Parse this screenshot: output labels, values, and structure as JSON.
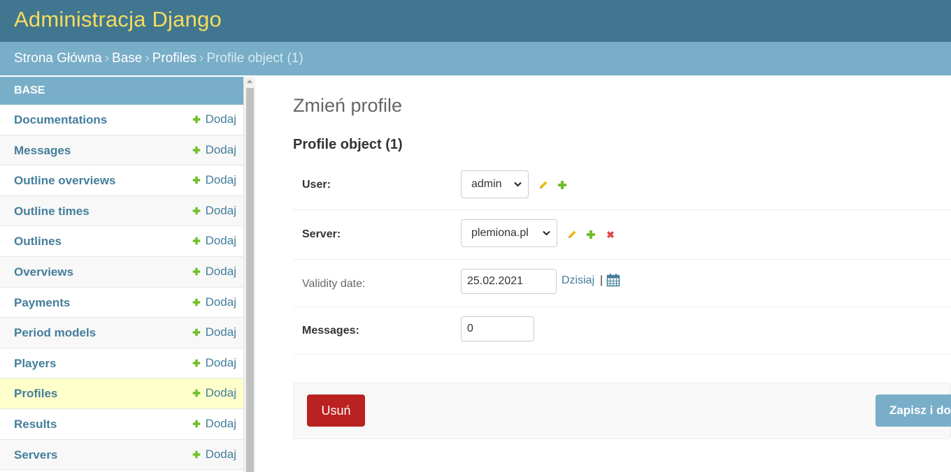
{
  "header": {
    "site_title": "Administracja Django"
  },
  "breadcrumbs": {
    "home": "Strona Główna",
    "app": "Base",
    "model": "Profiles",
    "current": "Profile object (1)",
    "separator": "›"
  },
  "sidebar": {
    "module_caption": "BASE",
    "add_label": "Dodaj",
    "items": [
      {
        "label": "Documentations"
      },
      {
        "label": "Messages"
      },
      {
        "label": "Outline overviews"
      },
      {
        "label": "Outline times"
      },
      {
        "label": "Outlines"
      },
      {
        "label": "Overviews"
      },
      {
        "label": "Payments"
      },
      {
        "label": "Period models"
      },
      {
        "label": "Players"
      },
      {
        "label": "Profiles",
        "current": true
      },
      {
        "label": "Results"
      },
      {
        "label": "Servers"
      }
    ]
  },
  "main": {
    "page_title": "Zmień profile",
    "object_heading": "Profile object (1)",
    "fields": {
      "user": {
        "label": "User:",
        "value": "admin"
      },
      "server": {
        "label": "Server:",
        "value": "plemiona.pl"
      },
      "validity_date": {
        "label": "Validity date:",
        "value": "25.02.2021",
        "today_label": "Dzisiaj",
        "separator": "|"
      },
      "messages": {
        "label": "Messages:",
        "value": "0"
      }
    },
    "actions": {
      "delete_label": "Usuń",
      "save_continue_label": "Zapisz i dodaj nowy"
    }
  },
  "colors": {
    "header_bg": "#417690",
    "title_yellow": "#f5dd5d",
    "breadcrumb_bg": "#79aec8",
    "link": "#447e9b",
    "add_green": "#70bf2b",
    "edit_yellow": "#efb80b",
    "delete_red": "#ba2121",
    "current_row": "#ffffcc"
  },
  "icons": {
    "add": "plus-icon",
    "change": "pencil-icon",
    "delete": "x-icon",
    "calendar": "calendar-icon",
    "dropdown": "chevron-down-icon"
  }
}
